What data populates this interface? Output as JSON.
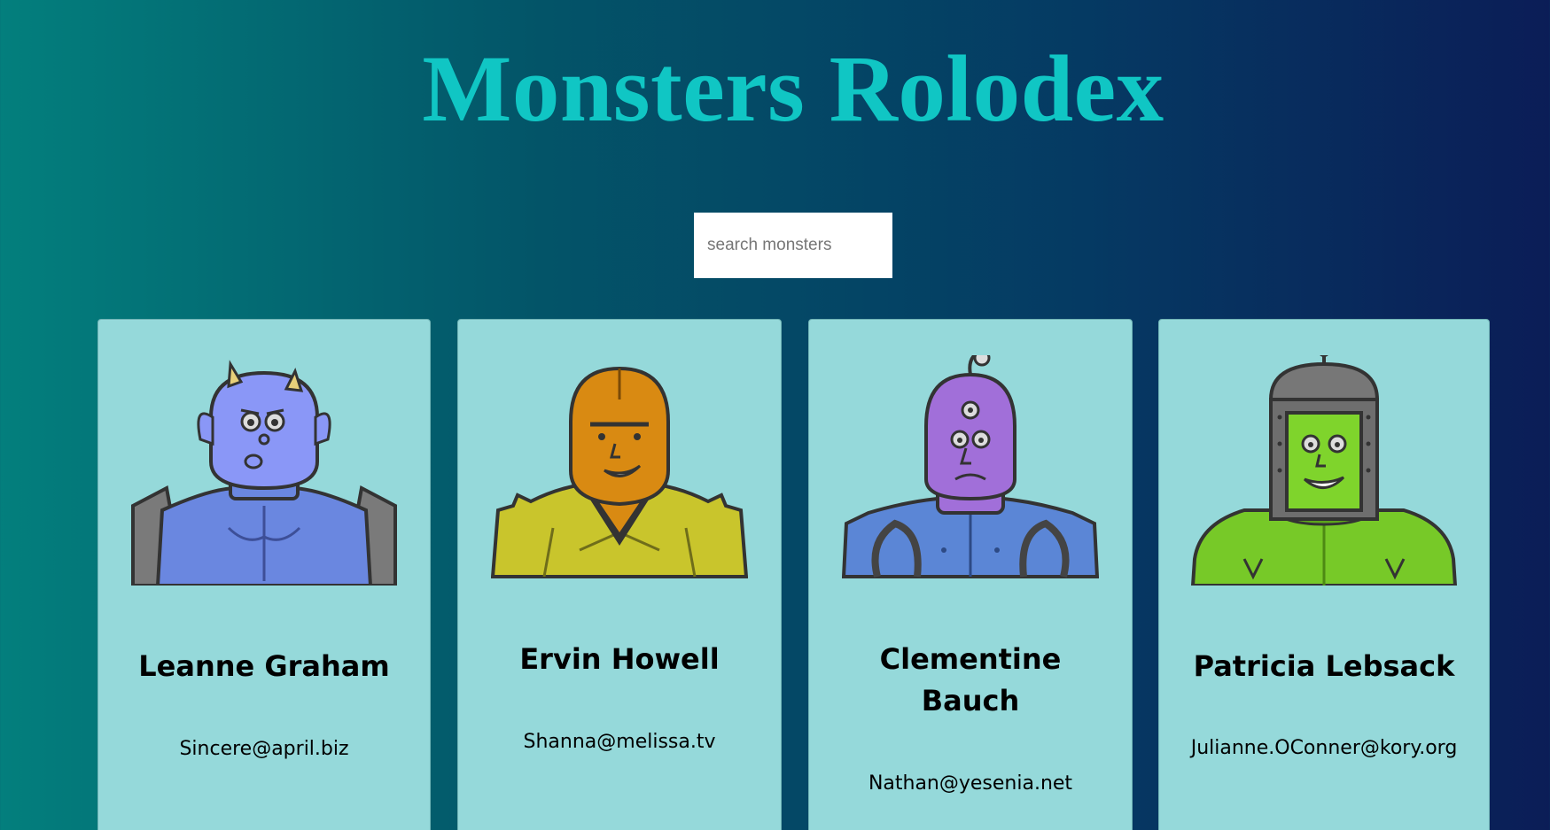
{
  "app": {
    "title": "Monsters Rolodex"
  },
  "search": {
    "placeholder": "search monsters",
    "value": ""
  },
  "monsters": [
    {
      "name": "Leanne Graham",
      "email": "Sincere@april.biz",
      "avatar": "blue-horned-monster",
      "color": "#7b8ef5"
    },
    {
      "name": "Ervin Howell",
      "email": "Shanna@melissa.tv",
      "avatar": "orange-masked-monster",
      "color": "#d98a12"
    },
    {
      "name": "Clementine Bauch",
      "email": "Nathan@yesenia.net",
      "avatar": "purple-cyclops-monster",
      "color": "#a16fd9"
    },
    {
      "name": "Patricia Lebsack",
      "email": "Julianne.OConner@kory.org",
      "avatar": "green-helmet-monster",
      "color": "#77c928"
    }
  ]
}
